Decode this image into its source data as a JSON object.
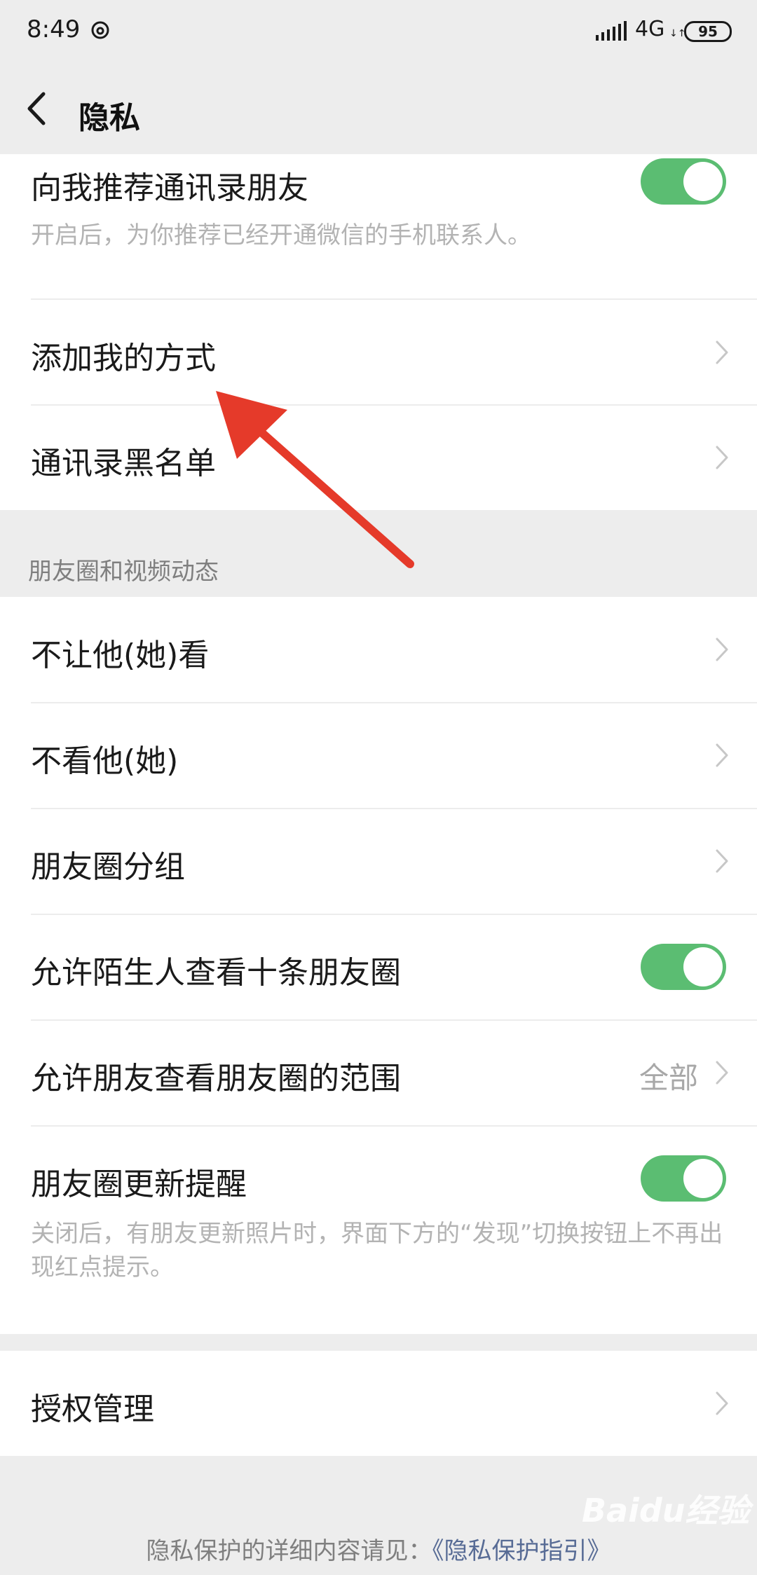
{
  "status_bar": {
    "time": "8:49",
    "network": "4G",
    "network_arrows": "↓↑",
    "battery": "95"
  },
  "nav": {
    "title": "隐私"
  },
  "group1": {
    "recommend_contacts": {
      "label": "向我推荐通讯录朋友",
      "description": "开启后，为你推荐已经开通微信的手机联系人。",
      "enabled": true
    },
    "add_methods": {
      "label": "添加我的方式"
    },
    "blocklist": {
      "label": "通讯录黑名单"
    }
  },
  "moments_section": {
    "header": "朋友圈和视频动态",
    "items": [
      {
        "label": "不让他(她)看"
      },
      {
        "label": "不看他(她)"
      },
      {
        "label": "朋友圈分组"
      },
      {
        "label": "允许陌生人查看十条朋友圈",
        "enabled": true
      },
      {
        "label": "允许朋友查看朋友圈的范围",
        "value": "全部"
      },
      {
        "label": "朋友圈更新提醒",
        "enabled": true,
        "description": "关闭后，有朋友更新照片时，界面下方的“发现”切换按钮上不再出现红点提示。"
      }
    ]
  },
  "group3": {
    "authorization": {
      "label": "授权管理"
    }
  },
  "footer": {
    "text": "隐私保护的详细内容请见：",
    "link": "《隐私保护指引》"
  },
  "watermark": "Baidu经验",
  "colors": {
    "toggle_on": "#5bbd72",
    "link": "#576b95",
    "arrow": "#e53a2a"
  }
}
